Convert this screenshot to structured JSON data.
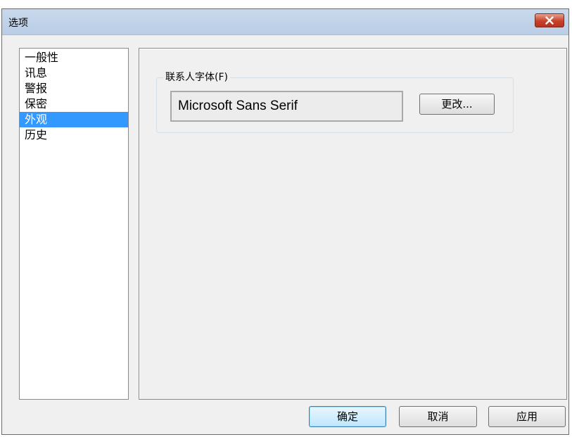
{
  "window": {
    "title": "选项",
    "close_icon": "close-icon"
  },
  "nav": {
    "items": [
      {
        "label": "一般性"
      },
      {
        "label": "讯息"
      },
      {
        "label": "警报"
      },
      {
        "label": "保密"
      },
      {
        "label": "外观",
        "selected": true
      },
      {
        "label": "历史"
      }
    ]
  },
  "appearance": {
    "group_label": "联系人字体(F)",
    "font_value": "Microsoft Sans Serif",
    "change_label": "更改..."
  },
  "footer": {
    "ok_label": "确定",
    "cancel_label": "取消",
    "apply_label": "应用"
  },
  "colors": {
    "selection": "#3399ff",
    "titlebar": "#c9d9ec",
    "close": "#c8412a"
  }
}
